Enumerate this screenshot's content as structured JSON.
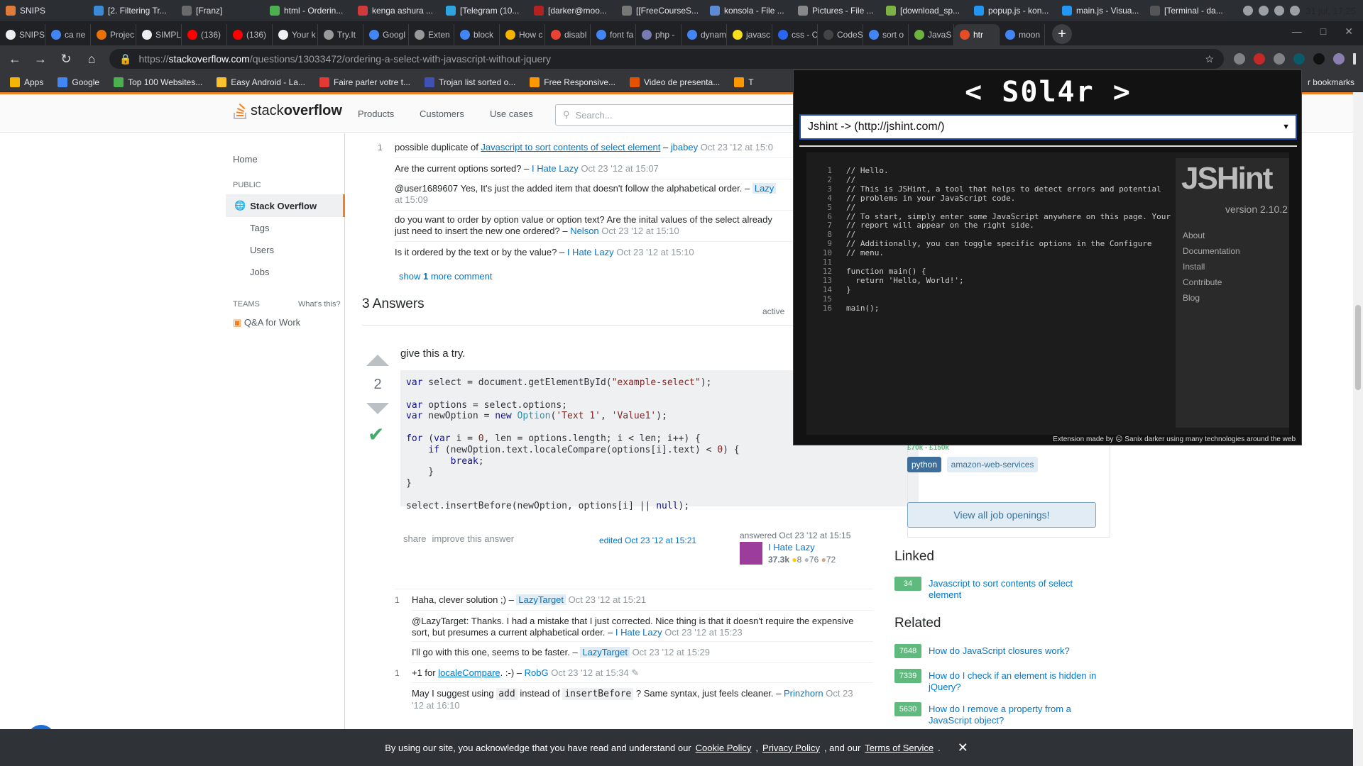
{
  "taskbar": {
    "items": [
      "SNIPS",
      "[2. Filtering Tr...",
      "[Franz]",
      "html - Orderin...",
      "kenga ashura ...",
      "[Telegram (10...",
      "[darker@moo...",
      "[[FreeCourseS...",
      "konsola - File ...",
      "Pictures - File ...",
      "[download_sp...",
      "popup.js - kon...",
      "main.js - Visua...",
      "[Terminal - da..."
    ],
    "clock": "31 jul, 17:25"
  },
  "browser_tabs": [
    "SNIPS",
    "ca ne",
    "Projec",
    "SIMPL",
    "(136)",
    "(136)",
    "Your k",
    "Try.It",
    "Googl",
    "Exten",
    "block",
    "How c",
    "disabl",
    "font fa",
    "php - ",
    "dynam",
    "javasc",
    "css - C",
    "CodeS",
    "sort o",
    "JavaS",
    "htr",
    "moon"
  ],
  "omnibox": {
    "scheme": "https://",
    "host": "stackoverflow.com",
    "path": "/questions/13033472/ordering-a-select-with-javascript-without-jquery"
  },
  "bookmarks": {
    "items": [
      "Apps",
      "Google",
      "Top 100 Websites...",
      "Easy Android - La...",
      "Faire parler votre t...",
      "Trojan list sorted o...",
      "Free Responsive...",
      "Video de presenta...",
      "T"
    ],
    "other": "r bookmarks"
  },
  "so_header": {
    "logo_prefix": "stack",
    "logo_suffix": "overflow",
    "nav": [
      "Products",
      "Customers",
      "Use cases"
    ],
    "search_placeholder": "Search..."
  },
  "leftnav": {
    "home": "Home",
    "public_label": "PUBLIC",
    "stack_overflow": "Stack Overflow",
    "tags": "Tags",
    "users": "Users",
    "jobs": "Jobs",
    "teams_label": "TEAMS",
    "whats_this": "What's this?",
    "qa_for_work": "Q&A for Work"
  },
  "question_comments": [
    {
      "score": "1",
      "pre": "possible duplicate of ",
      "link": "Javascript to sort contents of select element",
      "user": "jbabey",
      "date": "Oct 23 '12 at 15:0"
    },
    {
      "text": "Are the current options sorted? –",
      "user": "I Hate Lazy",
      "date": "Oct 23 '12 at 15:07"
    },
    {
      "text": "@user1689607 Yes, It's just the added item that doesn't follow the alphabetical order. –",
      "user": "Lazy",
      "date": "at 15:09"
    },
    {
      "text": "do you want to order by option value or option text? Are the inital values of the select already",
      "text2": "just need to insert the new one ordered? –",
      "user": "Nelson",
      "date": "Oct 23 '12 at 15:10"
    },
    {
      "text": "Is it ordered by the text or by the value? –",
      "user": "I Hate Lazy",
      "date": "Oct 23 '12 at 15:10"
    }
  ],
  "show_more": {
    "prefix": "show ",
    "count": "1",
    "suffix": " more comment"
  },
  "answers": {
    "title": "3 Answers",
    "active": "active",
    "vote_count": "2",
    "text": "give this a try.",
    "code_lines": [
      "var select = document.getElementById(\"example-select\");",
      "",
      "var options = select.options;",
      "var newOption = new Option('Text 1', 'Value1');",
      "",
      "for (var i = 0, len = options.length; i < len; i++) {",
      "    if (newOption.text.localeCompare(options[i].text) < 0) {",
      "        break;",
      "    }",
      "}",
      "",
      "select.insertBefore(newOption, options[i] || null);"
    ],
    "share": "share",
    "improve": "improve this answer",
    "edited": "edited Oct 23 '12 at 15:21",
    "answered": "answered Oct 23 '12 at 15:15",
    "user": "I Hate Lazy",
    "rep": "37.3k",
    "gold": "8",
    "silver": "76",
    "bronze": "72"
  },
  "answer_comments": [
    {
      "score": "1",
      "text": "Haha, clever solution ;) –",
      "user": "LazyTarget",
      "date": "Oct 23 '12 at 15:21"
    },
    {
      "text": "@LazyTarget: Thanks. I had a mistake that I just corrected. Nice thing is that it doesn't require the expensive",
      "text2": "sort, but presumes a current alphabetical order. –",
      "user": "I Hate Lazy",
      "date": "Oct 23 '12 at 15:23"
    },
    {
      "text": "I'll go with this one, seems to be faster. –",
      "user": "LazyTarget",
      "date": "Oct 23 '12 at 15:29"
    },
    {
      "score": "1",
      "pre": "+1 for ",
      "link": "localeCompare",
      "post": ". :-) –",
      "user": "RobG",
      "date": "Oct 23 '12 at 15:34"
    },
    {
      "text_a": "May I suggest using ",
      "code_a": "add",
      "text_b": " instead of ",
      "code_b": "insertBefore",
      "text_c": " ? Same syntax, just feels cleaner. –",
      "user": "Prinzhorn",
      "date": "Oct 23",
      "date2": "'12 at 16:10"
    }
  ],
  "rightcol": {
    "salary": "£70k - £150k",
    "tags": [
      "python",
      "amazon-web-services"
    ],
    "jobs_button": "View all job openings!",
    "linked_title": "Linked",
    "linked": [
      {
        "count": "34",
        "title": "Javascript to sort contents of select element"
      }
    ],
    "related_title": "Related",
    "related": [
      {
        "count": "7648",
        "title": "How do JavaScript closures work?"
      },
      {
        "count": "7339",
        "title": "How do I check if an element is hidden in jQuery?"
      },
      {
        "count": "5630",
        "title": "How do I remove a property from a JavaScript object?"
      }
    ]
  },
  "cookie": {
    "text": "By using our site, you acknowledge that you have read and understand our",
    "cookie_policy": "Cookie Policy",
    "privacy_policy": "Privacy Policy",
    "and_our": ", and our",
    "terms": "Terms of Service"
  },
  "popup": {
    "title": "< S0l4r >",
    "select_value": "Jshint -> (http://jshint.com/)",
    "code_lines": [
      "// Hello.",
      "//",
      "// This is JSHint, a tool that helps to detect errors and potential",
      "// problems in your JavaScript code.",
      "//",
      "// To start, simply enter some JavaScript anywhere on this page. Your",
      "// report will appear on the right side.",
      "//",
      "// Additionally, you can toggle specific options in the Configure",
      "// menu.",
      "",
      "function main() {",
      "  return 'Hello, World!';",
      "}",
      "",
      "main();"
    ],
    "logo": "JSHint",
    "version": "version 2.10.2",
    "links": [
      "About",
      "Documentation",
      "Install",
      "Contribute",
      "Blog"
    ],
    "footer": "Extension made by ☹ Sanix darker using many technologies around the web"
  }
}
